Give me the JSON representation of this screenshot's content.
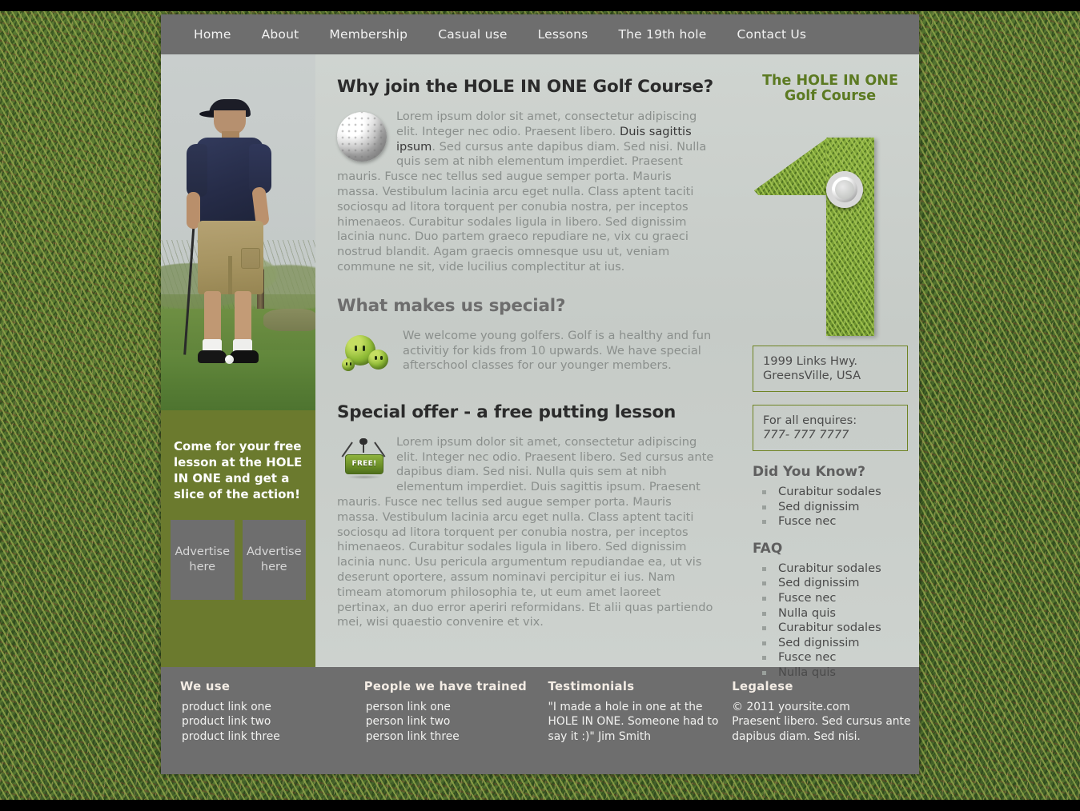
{
  "site": {
    "brand_line_1": "The HOLE IN ONE",
    "brand_line_2": "Golf Course",
    "logo_digit": "1"
  },
  "nav": {
    "items": [
      {
        "label": "Home"
      },
      {
        "label": "About"
      },
      {
        "label": "Membership"
      },
      {
        "label": "Casual use"
      },
      {
        "label": "Lessons"
      },
      {
        "label": "The 19th hole"
      },
      {
        "label": "Contact Us"
      }
    ]
  },
  "left": {
    "tagline": "Come for your free lesson at the HOLE IN ONE and get a slice of the action!",
    "ads": [
      {
        "label": "Advertise here"
      },
      {
        "label": "Advertise here"
      }
    ]
  },
  "main": {
    "section1": {
      "heading": "Why join the HOLE IN ONE Golf Course?",
      "icon": "golf-ball-icon",
      "text_before_emphasis": "Lorem ipsum dolor sit amet, consectetur adipiscing elit. Integer nec odio. Praesent libero. ",
      "emphasis": "Duis sagittis ipsum",
      "text_after_emphasis": ". Sed cursus ante dapibus diam. Sed nisi. Nulla quis sem at nibh elementum imperdiet. Praesent mauris. Fusce nec tellus sed augue semper porta. Mauris massa. Vestibulum lacinia arcu eget nulla. Class aptent taciti sociosqu ad litora torquent per conubia nostra, per inceptos himenaeos. Curabitur sodales ligula in libero. Sed dignissim lacinia nunc. Duo partem graeco repudiare ne, vix cu graeci nostrud blandit. Agam graecis omnesque usu ut, veniam commune ne sit, vide lucilius complectitur at ius."
    },
    "section2": {
      "heading": "What makes us special?",
      "icon": "kids-icon",
      "text": "We welcome young golfers. Golf is a healthy and fun activitiy for kids from 10 upwards. We have special afterschool classes for our younger members."
    },
    "section3": {
      "heading": "Special offer - a free putting lesson",
      "icon": "free-tag-icon",
      "tag_label": "FREE!",
      "text": "Lorem ipsum dolor sit amet, consectetur adipiscing elit. Integer nec odio. Praesent libero. Sed cursus ante dapibus diam. Sed nisi. Nulla quis sem at nibh elementum imperdiet. Duis sagittis ipsum. Praesent mauris. Fusce nec tellus sed augue semper porta. Mauris massa. Vestibulum lacinia arcu eget nulla. Class aptent taciti sociosqu ad litora torquent per conubia nostra, per inceptos himenaeos. Curabitur sodales ligula in libero. Sed dignissim lacinia nunc. Usu pericula argumentum repudiandae ea, ut vis deserunt oportere, assum nominavi percipitur ei ius. Nam timeam atomorum philosophia te, ut eum amet laoreet pertinax, an duo error aperiri reformidans. Et alii quas partiendo mei, wisi quaestio convenire et vix."
    }
  },
  "right": {
    "address_line_1": "1999 Links Hwy.",
    "address_line_2": "GreensVille, USA",
    "enquiries_label": "For all enquires:",
    "phone": "777- 777 7777",
    "did_you_know": {
      "heading": "Did You Know?",
      "items": [
        "Curabitur sodales",
        "Sed dignissim",
        "Fusce nec"
      ]
    },
    "faq": {
      "heading": "FAQ",
      "items": [
        "Curabitur sodales",
        "Sed dignissim",
        "Fusce nec",
        "Nulla quis",
        "Curabitur sodales",
        "Sed dignissim",
        "Fusce nec",
        "Nulla quis"
      ]
    }
  },
  "footer": {
    "col1": {
      "heading": "We use",
      "items": [
        "product link one",
        "product link two",
        "product link three"
      ]
    },
    "col2": {
      "heading": "People we have trained",
      "items": [
        "person link one",
        "person link two",
        "person link three"
      ]
    },
    "col3": {
      "heading": "Testimonials",
      "quote": "\"I made a hole in one at the HOLE IN ONE. Someone had to say it :)\" Jim Smith"
    },
    "col4": {
      "heading": "Legalese",
      "copyright": "© 2011 yoursite.com",
      "legal": "Praesent libero. Sed cursus ante dapibus diam. Sed nisi."
    }
  },
  "colors": {
    "nav_bg": "#6e6e6e",
    "page_bg": "#c9cecb",
    "left_col_green": "#6b7a2e",
    "brand_green": "#5c7a22",
    "box_border": "#6f8424",
    "footer_bg": "#6e6e6e"
  }
}
